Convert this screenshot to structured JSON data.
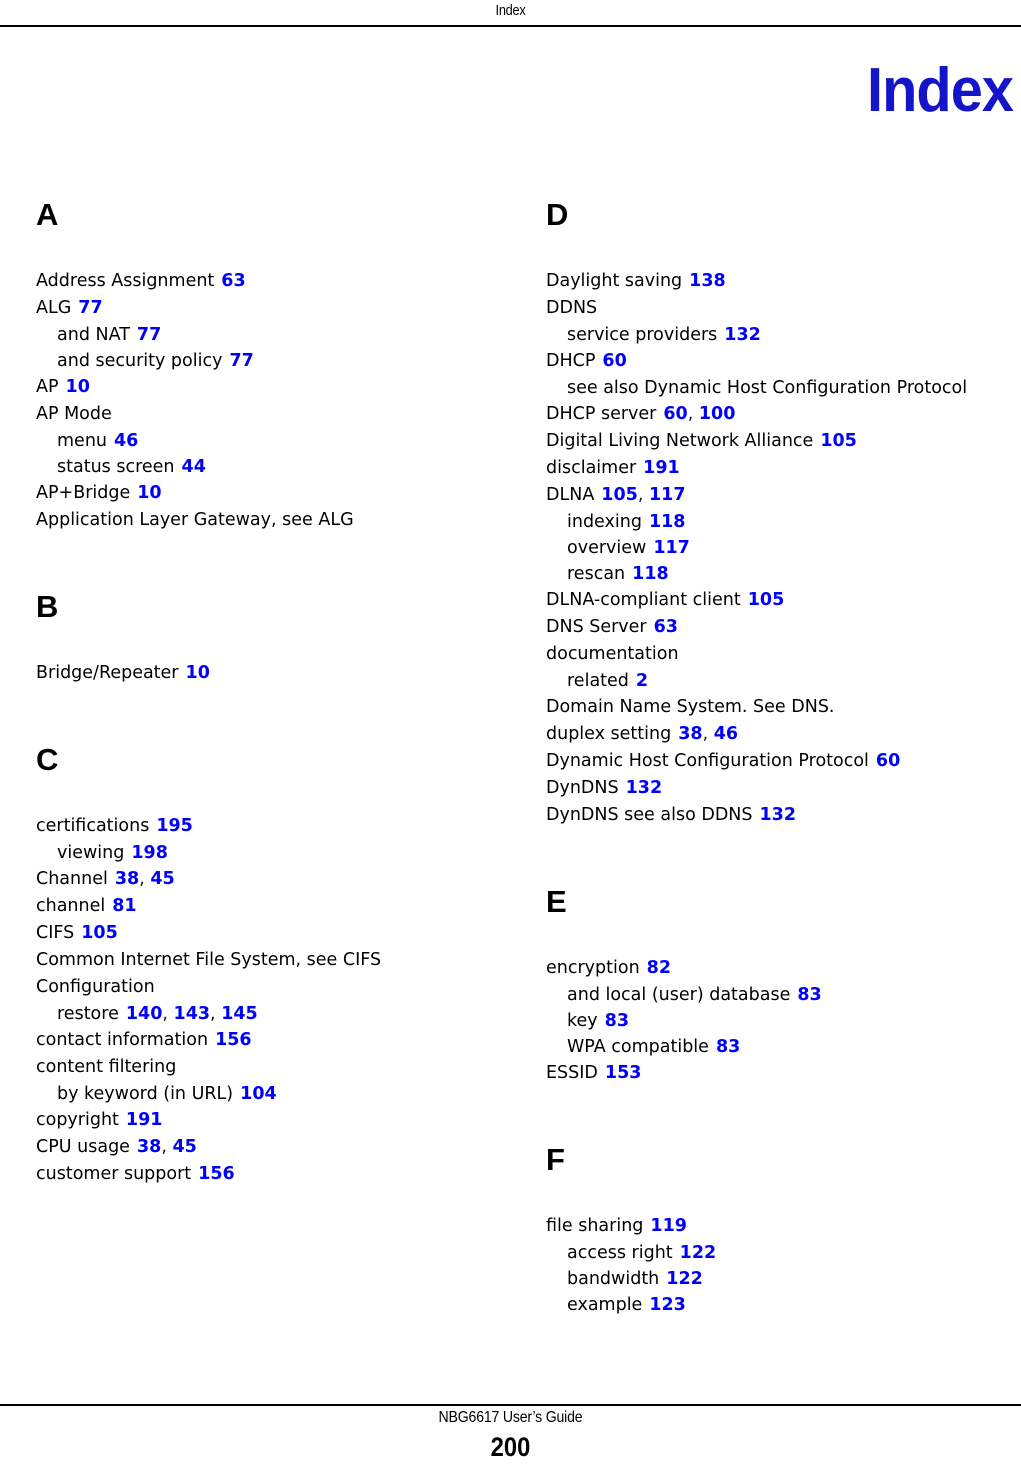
{
  "header": {
    "running_head": "Index"
  },
  "title": "Index",
  "footer": {
    "guide": "NBG6617 User’s Guide",
    "page_number": "200"
  },
  "colors": {
    "page_reference": "#0000FF",
    "chapter_title": "#1414C8",
    "text": "#000000"
  },
  "columns": [
    {
      "name": "left-column",
      "groups": [
        {
          "letter": "A",
          "entries": [
            {
              "term": "Address Assignment",
              "pages": [
                "63"
              ],
              "level": 0
            },
            {
              "term": "ALG",
              "pages": [
                "77"
              ],
              "level": 0
            },
            {
              "term": "and NAT",
              "pages": [
                "77"
              ],
              "level": 1
            },
            {
              "term": "and security policy",
              "pages": [
                "77"
              ],
              "level": 1
            },
            {
              "term": "AP",
              "pages": [
                "10"
              ],
              "level": 0
            },
            {
              "term": "AP Mode",
              "pages": [],
              "level": 0
            },
            {
              "term": "menu",
              "pages": [
                "46"
              ],
              "level": 1
            },
            {
              "term": "status screen",
              "pages": [
                "44"
              ],
              "level": 1
            },
            {
              "term": "AP+Bridge",
              "pages": [
                "10"
              ],
              "level": 0
            },
            {
              "term": "Application Layer Gateway, see ALG",
              "pages": [],
              "level": 0
            }
          ]
        },
        {
          "letter": "B",
          "entries": [
            {
              "term": "Bridge/Repeater",
              "pages": [
                "10"
              ],
              "level": 0
            }
          ]
        },
        {
          "letter": "C",
          "entries": [
            {
              "term": "certifications",
              "pages": [
                "195"
              ],
              "level": 0
            },
            {
              "term": "viewing",
              "pages": [
                "198"
              ],
              "level": 1
            },
            {
              "term": "Channel",
              "pages": [
                "38",
                "45"
              ],
              "level": 0
            },
            {
              "term": "channel",
              "pages": [
                "81"
              ],
              "level": 0
            },
            {
              "term": "CIFS",
              "pages": [
                "105"
              ],
              "level": 0
            },
            {
              "term": "Common Internet File System, see CIFS",
              "pages": [],
              "level": 0
            },
            {
              "term": "Configuration",
              "pages": [],
              "level": 0
            },
            {
              "term": "restore",
              "pages": [
                "140",
                "143",
                "145"
              ],
              "level": 1
            },
            {
              "term": "contact information",
              "pages": [
                "156"
              ],
              "level": 0
            },
            {
              "term": "content filtering",
              "pages": [],
              "level": 0
            },
            {
              "term": "by keyword (in URL)",
              "pages": [
                "104"
              ],
              "level": 1
            },
            {
              "term": "copyright",
              "pages": [
                "191"
              ],
              "level": 0
            },
            {
              "term": "CPU usage",
              "pages": [
                "38",
                "45"
              ],
              "level": 0
            },
            {
              "term": "customer support",
              "pages": [
                "156"
              ],
              "level": 0
            }
          ]
        }
      ]
    },
    {
      "name": "right-column",
      "groups": [
        {
          "letter": "D",
          "entries": [
            {
              "term": "Daylight saving",
              "pages": [
                "138"
              ],
              "level": 0
            },
            {
              "term": "DDNS",
              "pages": [],
              "level": 0
            },
            {
              "term": "service providers",
              "pages": [
                "132"
              ],
              "level": 1
            },
            {
              "term": "DHCP",
              "pages": [
                "60"
              ],
              "level": 0
            },
            {
              "term": "see also Dynamic Host Configuration Protocol",
              "pages": [],
              "level": 1
            },
            {
              "term": "DHCP server",
              "pages": [
                "60",
                "100"
              ],
              "level": 0
            },
            {
              "term": "Digital Living Network Alliance",
              "pages": [
                "105"
              ],
              "level": 0
            },
            {
              "term": "disclaimer",
              "pages": [
                "191"
              ],
              "level": 0
            },
            {
              "term": "DLNA",
              "pages": [
                "105",
                "117"
              ],
              "level": 0
            },
            {
              "term": "indexing",
              "pages": [
                "118"
              ],
              "level": 1
            },
            {
              "term": "overview",
              "pages": [
                "117"
              ],
              "level": 1
            },
            {
              "term": "rescan",
              "pages": [
                "118"
              ],
              "level": 1
            },
            {
              "term": "DLNA-compliant client",
              "pages": [
                "105"
              ],
              "level": 0
            },
            {
              "term": "DNS Server",
              "pages": [
                "63"
              ],
              "level": 0
            },
            {
              "term": "documentation",
              "pages": [],
              "level": 0
            },
            {
              "term": "related",
              "pages": [
                "2"
              ],
              "level": 1
            },
            {
              "term": "Domain Name System. See DNS.",
              "pages": [],
              "level": 0
            },
            {
              "term": "duplex setting",
              "pages": [
                "38",
                "46"
              ],
              "level": 0
            },
            {
              "term": "Dynamic Host Configuration Protocol",
              "pages": [
                "60"
              ],
              "level": 0
            },
            {
              "term": "DynDNS",
              "pages": [
                "132"
              ],
              "level": 0
            },
            {
              "term": "DynDNS see also DDNS",
              "pages": [
                "132"
              ],
              "level": 0
            }
          ]
        },
        {
          "letter": "E",
          "entries": [
            {
              "term": "encryption",
              "pages": [
                "82"
              ],
              "level": 0
            },
            {
              "term": "and local (user) database",
              "pages": [
                "83"
              ],
              "level": 1
            },
            {
              "term": "key",
              "pages": [
                "83"
              ],
              "level": 1
            },
            {
              "term": "WPA compatible",
              "pages": [
                "83"
              ],
              "level": 1
            },
            {
              "term": "ESSID",
              "pages": [
                "153"
              ],
              "level": 0
            }
          ]
        },
        {
          "letter": "F",
          "entries": [
            {
              "term": "file sharing",
              "pages": [
                "119"
              ],
              "level": 0
            },
            {
              "term": "access right",
              "pages": [
                "122"
              ],
              "level": 1
            },
            {
              "term": "bandwidth",
              "pages": [
                "122"
              ],
              "level": 1
            },
            {
              "term": "example",
              "pages": [
                "123"
              ],
              "level": 1
            }
          ]
        }
      ]
    }
  ]
}
